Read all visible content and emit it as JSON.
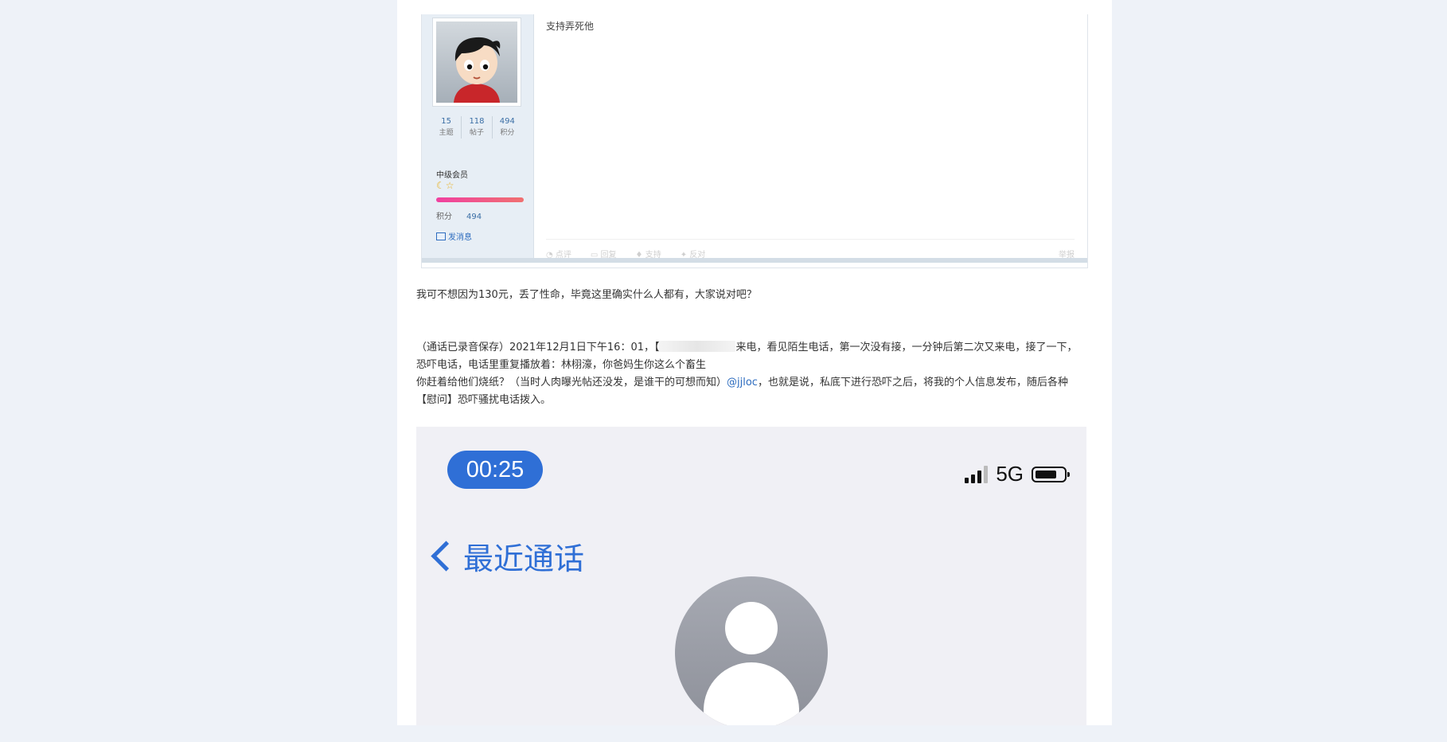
{
  "post": {
    "reply_text": "支持弄死他",
    "user": {
      "stats": [
        {
          "value": "15",
          "label": "主题"
        },
        {
          "value": "118",
          "label": "帖子"
        },
        {
          "value": "494",
          "label": "积分"
        }
      ],
      "rank": "中级会员",
      "stars": "☾☆",
      "points_label": "积分",
      "points_value": "494",
      "message_label": "发消息"
    },
    "actions": {
      "comment": "点评",
      "reply": "回复",
      "support": "支持",
      "oppose": "反对",
      "report": "举报"
    }
  },
  "article": {
    "p1": "我可不想因为130元，丢了性命，毕竟这里确实什么人都有，大家说对吧？",
    "p2_part1": "（通话已录音保存）2021年12月1日下午16：01，【",
    "p2_part2": "来电，看见陌生电话，第一次没有接，一分钟后第二次又来电，接了一下，恐吓电话，电话里重复播放着：林栩濠，你爸妈生你这么个畜生",
    "p3_part1": "你赶着给他们烧纸？（当时人肉曝光帖还没发，是谁干的可想而知）",
    "p3_mention": "@jjloc",
    "p3_part2": "，也就是说，私底下进行恐吓之后，将我的个人信息发布，随后各种【慰问】恐吓骚扰电话拨入。"
  },
  "phone": {
    "call_timer": "00:25",
    "network": "5G",
    "back_label": "最近通话",
    "battery_level_pct": 75,
    "signal_bars_active": 3
  },
  "colors": {
    "accent_blue": "#2f6fd6",
    "link_blue": "#2d6cbf",
    "background": "#eef2f8"
  }
}
